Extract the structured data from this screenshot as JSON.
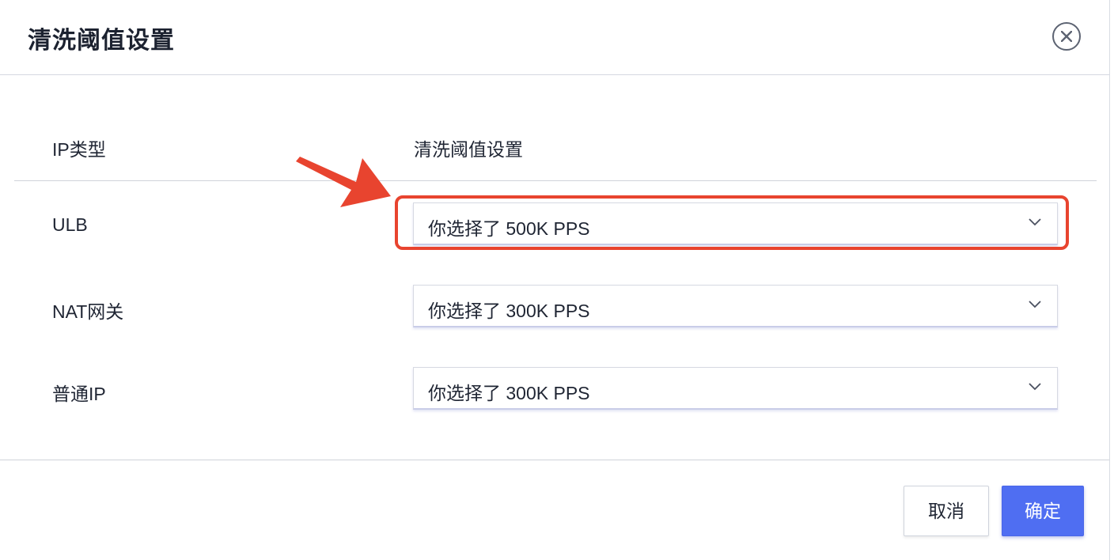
{
  "dialog": {
    "title": "清洗阈值设置",
    "close_icon": "close-icon"
  },
  "table": {
    "headers": {
      "ip_type": "IP类型",
      "threshold": "清洗阈值设置"
    },
    "rows": [
      {
        "label": "ULB",
        "value": "你选择了 500K PPS"
      },
      {
        "label": "NAT网关",
        "value": "你选择了 300K PPS"
      },
      {
        "label": "普通IP",
        "value": "你选择了 300K PPS"
      }
    ]
  },
  "footer": {
    "cancel_label": "取消",
    "confirm_label": "确定"
  },
  "colors": {
    "accent": "#4f6ef2",
    "annotation": "#e8442f"
  }
}
